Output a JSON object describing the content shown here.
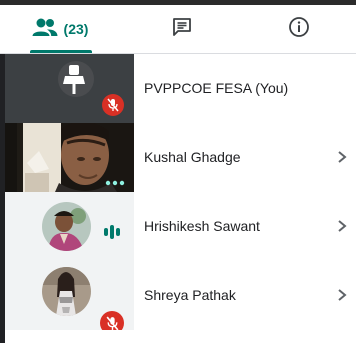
{
  "tabs": {
    "people_count": "(23)",
    "accent_color": "#00796b",
    "items": [
      {
        "id": "people",
        "icon": "people-icon",
        "active": true
      },
      {
        "id": "chat",
        "icon": "chat-icon",
        "active": false
      },
      {
        "id": "info",
        "icon": "info-icon",
        "active": false
      }
    ]
  },
  "participants": [
    {
      "name": "PVPPCOE FESA (You)",
      "tile": "generic-avatar",
      "mic_muted": true,
      "has_chevron": false
    },
    {
      "name": "Kushal Ghadge",
      "tile": "video",
      "mic_muted": false,
      "has_more_dots": true,
      "has_chevron": true
    },
    {
      "name": "Hrishikesh Sawant",
      "tile": "photo-avatar",
      "mic_muted": false,
      "speaking": true,
      "has_chevron": true
    },
    {
      "name": "Shreya Pathak",
      "tile": "photo-avatar",
      "mic_muted": true,
      "has_chevron": true
    }
  ],
  "colors": {
    "mic_off": "#d93025",
    "speaking": "#00796b"
  }
}
